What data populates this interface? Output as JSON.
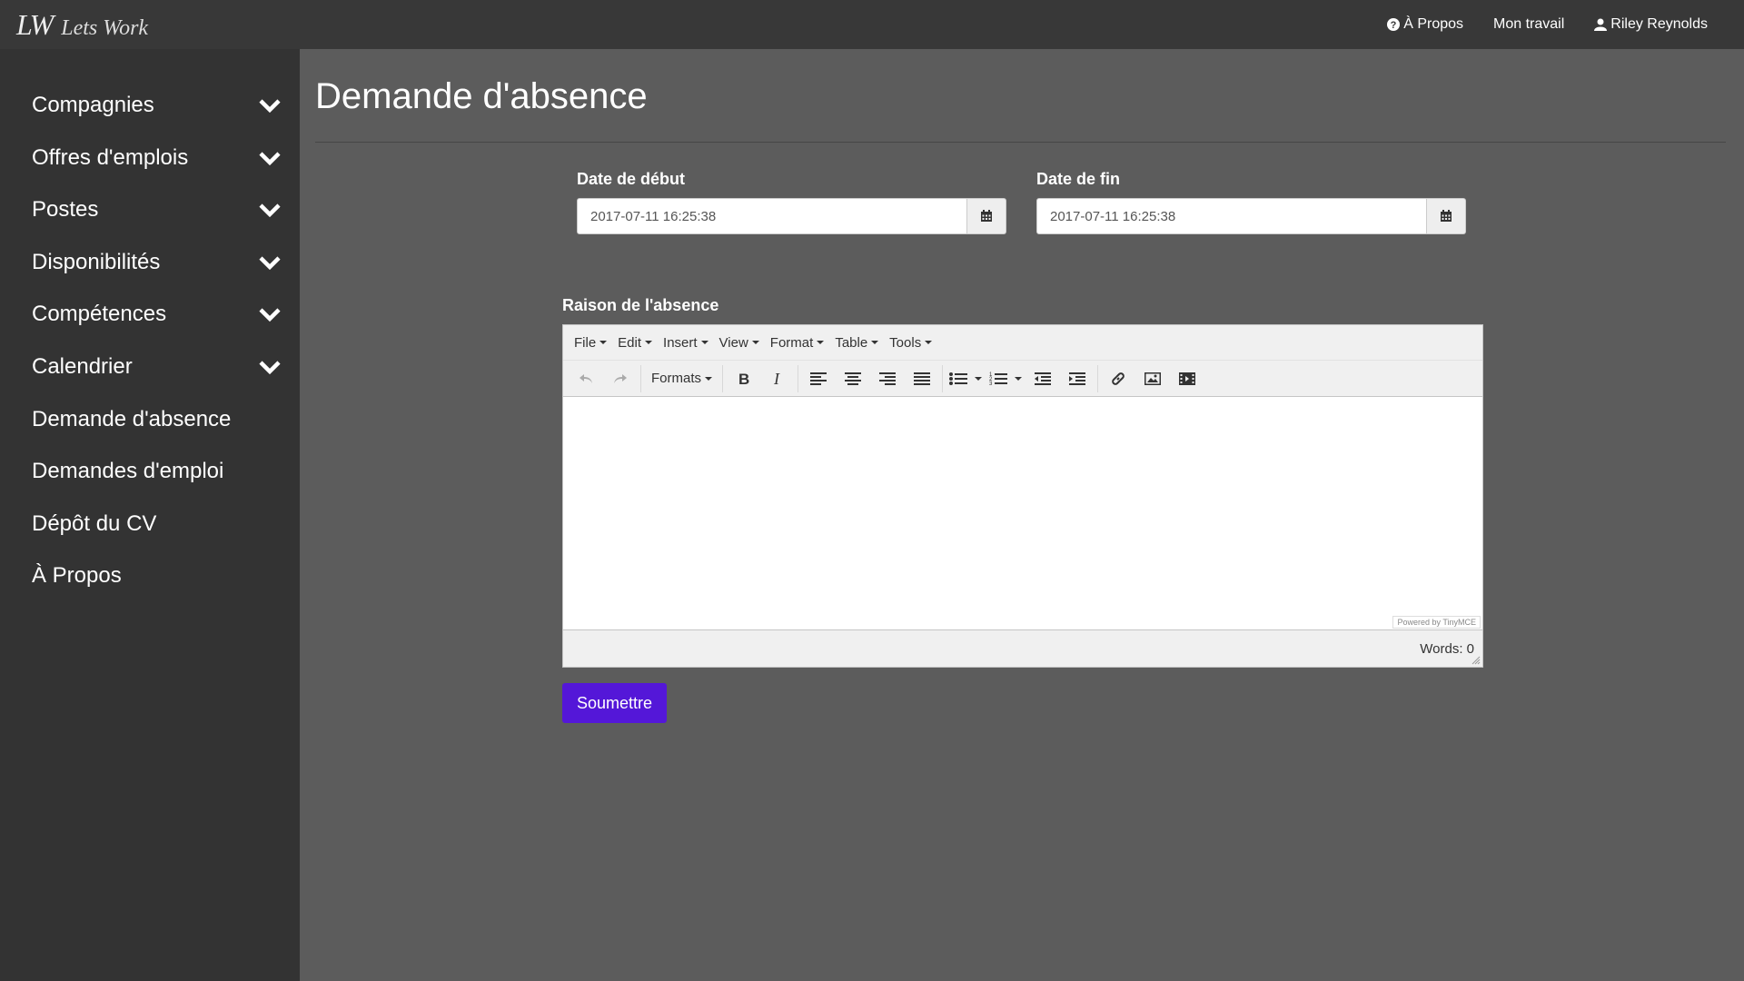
{
  "brand": {
    "logo": "LW",
    "name": "Lets Work"
  },
  "navbar": {
    "about": "À Propos",
    "my_work": "Mon travail",
    "user": "Riley Reynolds"
  },
  "sidebar": {
    "items": [
      {
        "label": "Compagnies",
        "expandable": true
      },
      {
        "label": "Offres d'emplois",
        "expandable": true
      },
      {
        "label": "Postes",
        "expandable": true
      },
      {
        "label": "Disponibilités",
        "expandable": true
      },
      {
        "label": "Compétences",
        "expandable": true
      },
      {
        "label": "Calendrier",
        "expandable": true
      },
      {
        "label": "Demande d'absence",
        "expandable": false
      },
      {
        "label": "Demandes d'emploi",
        "expandable": false
      },
      {
        "label": "Dépôt du CV",
        "expandable": false
      },
      {
        "label": "À Propos",
        "expandable": false
      }
    ]
  },
  "page": {
    "title": "Demande d'absence"
  },
  "form": {
    "start_label": "Date de début",
    "start_value": "2017-07-11 16:25:38",
    "end_label": "Date de fin",
    "end_value": "2017-07-11 16:25:38",
    "reason_label": "Raison de l'absence",
    "submit_label": "Soumettre"
  },
  "editor": {
    "menus": [
      "File",
      "Edit",
      "Insert",
      "View",
      "Format",
      "Table",
      "Tools"
    ],
    "formats_label": "Formats",
    "powered_by": "Powered by TinyMCE",
    "word_count": "Words: 0"
  },
  "colors": {
    "navbar_bg": "#383838",
    "sidebar_bg": "#333333",
    "main_bg": "#5c5c5c",
    "submit_bg": "#5417d8"
  }
}
